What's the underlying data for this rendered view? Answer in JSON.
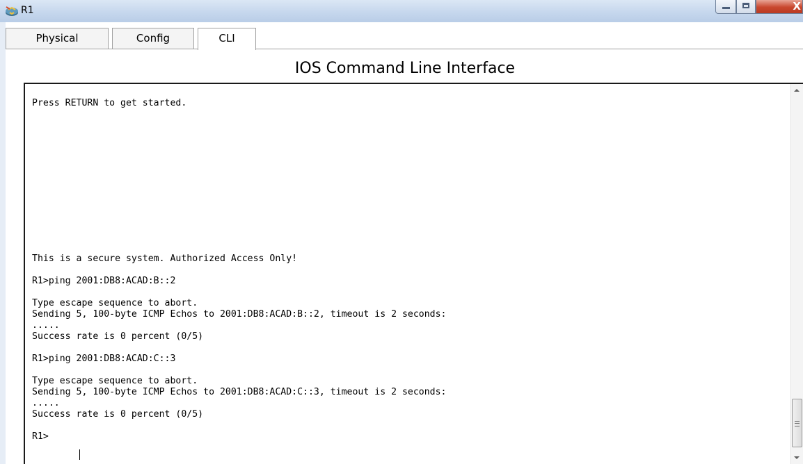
{
  "window": {
    "title": "R1",
    "icon": "router-icon",
    "controls": [
      "minimize-icon",
      "maximize-icon",
      "close-icon"
    ]
  },
  "tabs": [
    {
      "label": "Physical",
      "active": false
    },
    {
      "label": "Config",
      "active": false
    },
    {
      "label": "CLI",
      "active": true
    }
  ],
  "cli": {
    "heading": "IOS Command Line Interface",
    "lines": [
      "Press RETURN to get started.",
      "",
      "",
      "",
      "",
      "",
      "",
      "",
      "",
      "",
      "",
      "",
      "",
      "",
      "This is a secure system. Authorized Access Only!",
      "",
      "R1>ping 2001:DB8:ACAD:B::2",
      "",
      "Type escape sequence to abort.",
      "Sending 5, 100-byte ICMP Echos to 2001:DB8:ACAD:B::2, timeout is 2 seconds:",
      ".....",
      "Success rate is 0 percent (0/5)",
      "",
      "R1>ping 2001:DB8:ACAD:C::3",
      "",
      "Type escape sequence to abort.",
      "Sending 5, 100-byte ICMP Echos to 2001:DB8:ACAD:C::3, timeout is 2 seconds:",
      ".....",
      "Success rate is 0 percent (0/5)",
      "",
      "R1>"
    ]
  },
  "colors": {
    "titlebar": "#c6d7ed",
    "close_button": "#c9472e",
    "terminal_bg": "#ffffff",
    "text": "#000000"
  }
}
